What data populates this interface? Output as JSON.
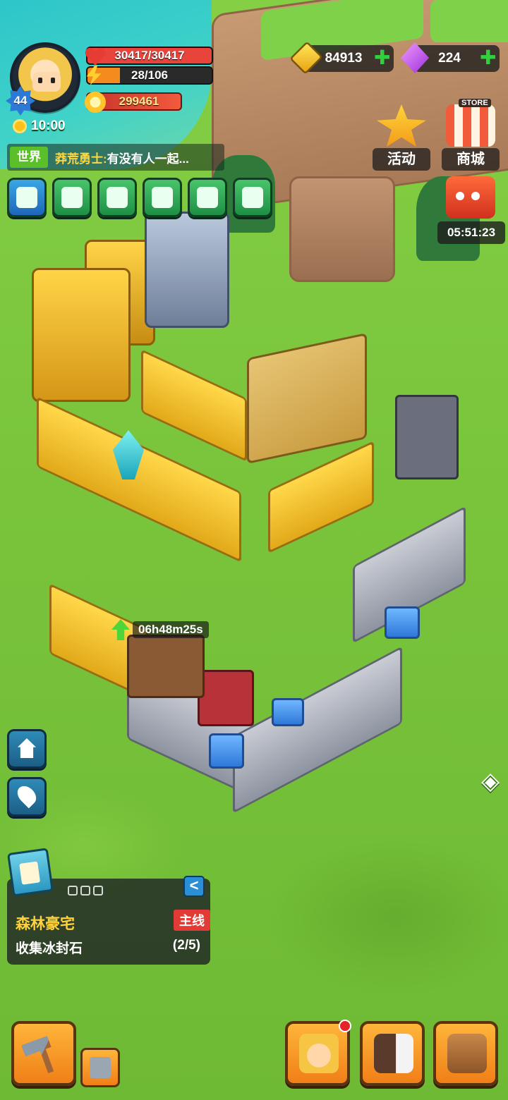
{
  "player": {
    "level": "44",
    "hp": "30417/30417",
    "hp_fill_fraction": 1.0,
    "energy": "28/106",
    "energy_fill_fraction": 0.26,
    "power": "299461",
    "time": "10:00"
  },
  "currencies": {
    "gold": "84913",
    "gems": "224",
    "plus_symbol": "✚"
  },
  "chat": {
    "channel": "世界",
    "sender": "莽荒勇士:",
    "message": " 有没有人一起..."
  },
  "side_buttons": {
    "activity": "活动",
    "store": "商城",
    "store_tag": "STORE",
    "gift_timer": "05:51:23"
  },
  "build_timer": "06h48m25s",
  "quest": {
    "title": "森林豪宅",
    "tag": "主线",
    "task": "收集冰封石",
    "progress": "(2/5)",
    "collapse_symbol": "<"
  },
  "share_symbol": "◈",
  "icons": [
    "sun-icon",
    "heart-icon",
    "bolt-icon",
    "power-icon",
    "gold-icon",
    "gem-icon",
    "home-icon",
    "pin-icon",
    "hammer-icon",
    "hero-icon",
    "pets-icon",
    "bag-icon"
  ],
  "colors": {
    "hp_bar": "#e8443b",
    "energy_bar": "#f58a1f",
    "power_bar": "#e8463a",
    "accent_green": "#5bbf2a",
    "quest_title": "#ffd23b",
    "quest_tag": "#e23b36"
  }
}
